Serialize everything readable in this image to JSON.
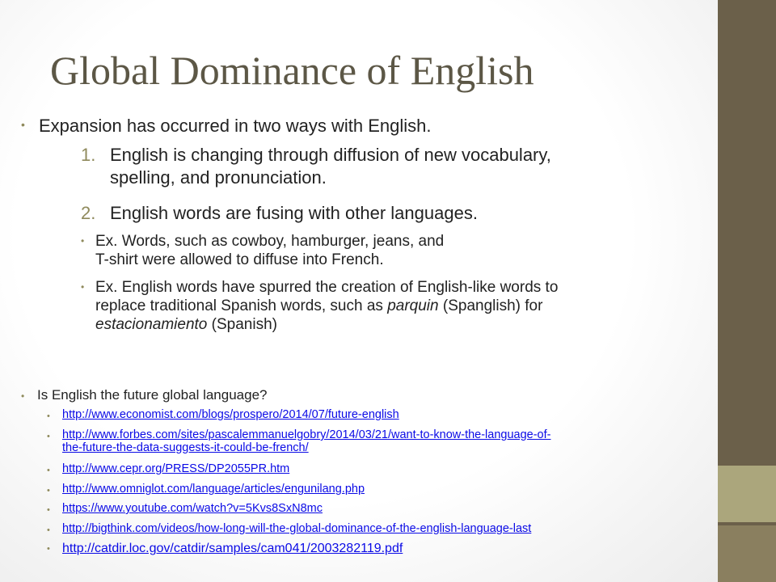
{
  "slide": {
    "title": "Global Dominance of English",
    "intro": "Expansion has occurred in two ways with English.",
    "numbered": [
      {
        "num": "1.",
        "line1": "English is changing through diffusion of new vocabulary,",
        "line2": "spelling, and pronunciation."
      },
      {
        "num": "2.",
        "line1": "English words are fusing with other languages."
      }
    ],
    "examples": [
      {
        "line1": "Ex. Words, such as cowboy, hamburger, jeans, and",
        "line2": "T-shirt were allowed to diffuse into French."
      },
      {
        "line1": "Ex. English words have spurred the creation of English-like words to",
        "line2_a": "replace traditional Spanish words, such as ",
        "line2_italic": "parquin",
        "line2_b": " (Spanglish) for",
        "line3_italic": "estacionamiento",
        "line3_b": " (Spanish)"
      }
    ],
    "question": "Is English the future global language?",
    "links": [
      {
        "line1": "http://www.economist.com/blogs/prospero/2014/07/future-english"
      },
      {
        "line1": "http://www.forbes.com/sites/pascalemmanuelgobry/2014/03/21/want-to-know-the-language-of-",
        "line2": "the-future-the-data-suggests-it-could-be-french/"
      },
      {
        "line1": "http://www.cepr.org/PRESS/DP2055PR.htm"
      },
      {
        "line1": "http://www.omniglot.com/language/articles/engunilang.php"
      },
      {
        "line1": "https://www.youtube.com/watch?v=5Kvs8SxN8mc"
      },
      {
        "line1": "http://bigthink.com/videos/how-long-will-the-global-dominance-of-the-english-language-last"
      },
      {
        "line1": "http://catdir.loc.gov/catdir/samples/cam041/2003282119.pdf"
      }
    ]
  },
  "colors": {
    "title": "#5c5746",
    "accent": "#8f8a5c",
    "sidebar": "#6b604a",
    "sidebar_light": "#aba67c",
    "link": "#0a0ae6"
  }
}
